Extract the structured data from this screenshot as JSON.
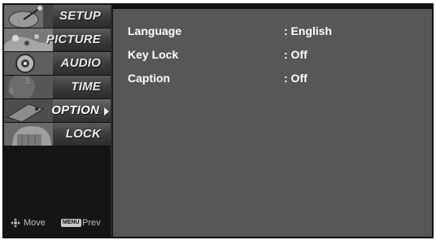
{
  "menu": {
    "items": [
      {
        "label": "SETUP",
        "icon": "satellite-dish-icon",
        "selected": false
      },
      {
        "label": "PICTURE",
        "icon": "palette-icon",
        "selected": false
      },
      {
        "label": "AUDIO",
        "icon": "speaker-icon",
        "selected": false
      },
      {
        "label": "TIME",
        "icon": "clock-icon",
        "selected": false
      },
      {
        "label": "OPTION",
        "icon": "option-tag-icon",
        "selected": true
      },
      {
        "label": "LOCK",
        "icon": "lock-icon",
        "selected": false
      }
    ]
  },
  "footer": {
    "move_label": "Move",
    "menu_key_label": "MENU",
    "prev_label": "Prev"
  },
  "settings": [
    {
      "name": "Language",
      "value": ": English"
    },
    {
      "name": "Key Lock",
      "value": ": Off"
    },
    {
      "name": "Caption",
      "value": ": Off"
    }
  ],
  "colors": {
    "panel_background": "#575757",
    "sidebar_background": "#151515",
    "text": "#ffffff"
  }
}
